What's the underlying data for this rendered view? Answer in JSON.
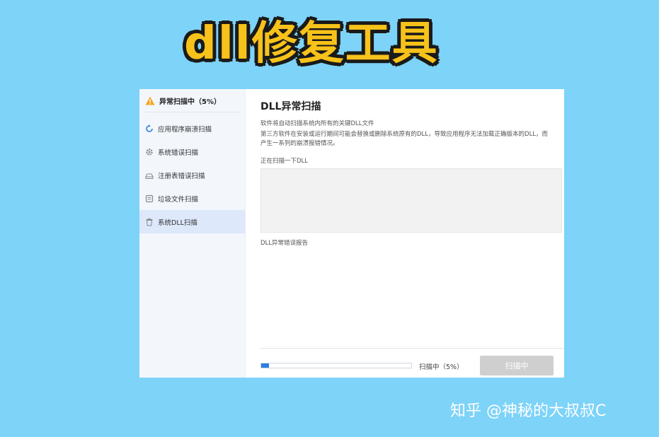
{
  "banner": {
    "title": "dll修复工具"
  },
  "sidebar": {
    "header": "异常扫描中（5%）",
    "items": [
      {
        "label": "应用程序崩溃扫描",
        "icon": "refresh-icon"
      },
      {
        "label": "系统错误扫描",
        "icon": "gear-icon"
      },
      {
        "label": "注册表错误扫描",
        "icon": "drive-icon"
      },
      {
        "label": "垃圾文件扫描",
        "icon": "file-icon"
      },
      {
        "label": "系统DLL扫描",
        "icon": "trash-icon",
        "active": true
      }
    ]
  },
  "main": {
    "title": "DLL异常扫描",
    "desc1": "软件将自动扫描系统内所有的关键DLL文件",
    "desc2": "第三方软件在安装或运行期间可能会替换或删除系统原有的DLL，导致应用程序无法加载正确版本的DLL，而产生一系列的崩溃报错情况。",
    "scan_label": "正在扫描一下DLL",
    "report_label": "DLL异常错误报告",
    "progress": {
      "percent": 5,
      "text": "扫描中（5%）"
    },
    "button_label": "扫描中"
  },
  "watermark": "知乎 @神秘的大叔叔C",
  "colors": {
    "accent": "#2f7de1",
    "warning": "#f5a623",
    "background": "#7dd3f8"
  }
}
